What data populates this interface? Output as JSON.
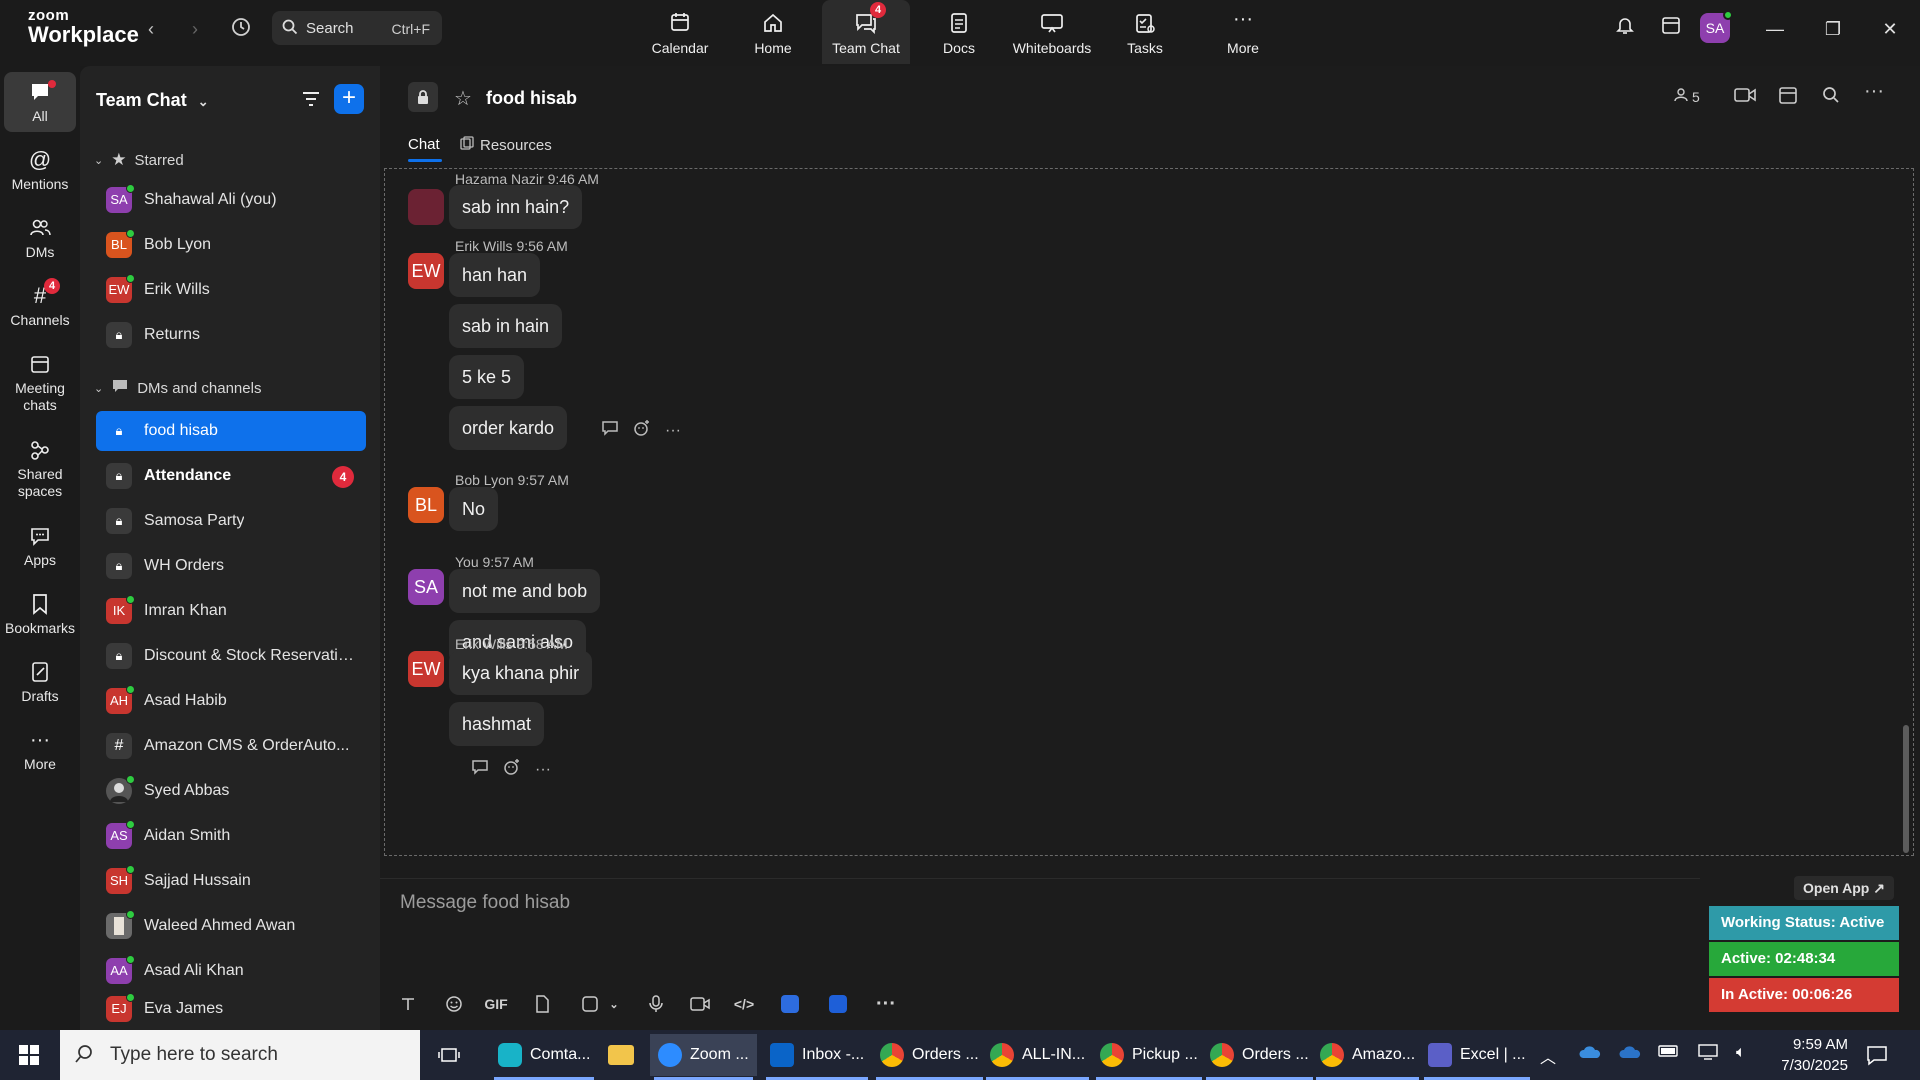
{
  "app": {
    "brand_top": "zoom",
    "brand_bottom": "Workplace"
  },
  "search": {
    "label": "Search",
    "shortcut": "Ctrl+F"
  },
  "top_nav": [
    {
      "label": "Calendar",
      "icon": "calendar-icon"
    },
    {
      "label": "Home",
      "icon": "home-icon"
    },
    {
      "label": "Team Chat",
      "icon": "chat-icon",
      "badge": "4",
      "active": true
    },
    {
      "label": "Docs",
      "icon": "docs-icon"
    },
    {
      "label": "Whiteboards",
      "icon": "whiteboard-icon"
    },
    {
      "label": "Tasks",
      "icon": "tasks-icon"
    },
    {
      "label": "More",
      "icon": "more-icon"
    }
  ],
  "user_initials": "SA",
  "rail": [
    {
      "label": "All",
      "icon": "chat-bubble-icon",
      "active": true
    },
    {
      "label": "Mentions",
      "icon": "at-icon"
    },
    {
      "label": "DMs",
      "icon": "people-icon"
    },
    {
      "label": "Channels",
      "icon": "hash-icon",
      "badge": "4"
    },
    {
      "label": "Meeting chats",
      "icon": "calendar-icon"
    },
    {
      "label": "Shared spaces",
      "icon": "shared-icon"
    },
    {
      "label": "Apps",
      "icon": "apps-icon"
    },
    {
      "label": "Bookmarks",
      "icon": "bookmark-icon"
    },
    {
      "label": "Drafts",
      "icon": "drafts-icon"
    },
    {
      "label": "More",
      "icon": "more-icon"
    }
  ],
  "sidebar": {
    "title": "Team Chat",
    "starred_label": "Starred",
    "starred": [
      {
        "name": "Shahawal Ali (you)",
        "initials": "SA",
        "color": "#8e3fae",
        "presence": true
      },
      {
        "name": "Bob Lyon",
        "initials": "BL",
        "color": "#d9541e",
        "presence": true
      },
      {
        "name": "Erik Wills",
        "initials": "EW",
        "color": "#c8362f",
        "presence": true
      },
      {
        "name": "Returns",
        "type": "locked"
      }
    ],
    "dms_label": "DMs and channels",
    "items": [
      {
        "name": "food hisab",
        "type": "locked",
        "active": true
      },
      {
        "name": "Attendance",
        "type": "locked",
        "bold": true,
        "badge": "4"
      },
      {
        "name": "Samosa Party",
        "type": "locked"
      },
      {
        "name": "WH Orders",
        "type": "locked"
      },
      {
        "name": "Imran Khan",
        "initials": "IK",
        "color": "#c8362f",
        "presence": true
      },
      {
        "name": "Discount & Stock Reservatio...",
        "type": "locked"
      },
      {
        "name": "Asad Habib",
        "initials": "AH",
        "color": "#c8362f",
        "presence": true
      },
      {
        "name": "Amazon CMS & OrderAuto...",
        "type": "hash"
      },
      {
        "name": "Syed Abbas",
        "type": "photo",
        "presence": true
      },
      {
        "name": "Aidan Smith",
        "initials": "AS",
        "color": "#8e3fae",
        "presence": true
      },
      {
        "name": "Sajjad Hussain",
        "initials": "SH",
        "color": "#c8362f",
        "presence": true
      },
      {
        "name": "Waleed Ahmed Awan",
        "type": "photo",
        "presence": true
      },
      {
        "name": "Asad Ali Khan",
        "initials": "AA",
        "color": "#8e3fae",
        "presence": true
      },
      {
        "name": "Eva James",
        "initials": "EJ",
        "color": "#c8362f",
        "presence": true
      }
    ]
  },
  "channel": {
    "title": "food hisab",
    "member_count": "5"
  },
  "tabs": [
    {
      "label": "Chat",
      "active": true
    },
    {
      "label": "Resources"
    }
  ],
  "messages": [
    {
      "sender": "Hazama Nazir",
      "time": "9:46 AM",
      "avatar_color": "#6b2233",
      "initials": "",
      "bubbles": [
        "sab inn hain?"
      ]
    },
    {
      "sender": "Erik Wills",
      "time": "9:56 AM",
      "avatar_color": "#c8362f",
      "initials": "EW",
      "bubbles": [
        "han han",
        "sab in hain",
        "5 ke 5",
        "order kardo"
      ]
    },
    {
      "sender": "Bob Lyon",
      "time": "9:57 AM",
      "avatar_color": "#d9541e",
      "initials": "BL",
      "bubbles": [
        "No"
      ]
    },
    {
      "sender": "You",
      "time": "9:57 AM",
      "avatar_color": "#8e3fae",
      "initials": "SA",
      "bubbles": [
        "not me and bob",
        "and sami also"
      ]
    },
    {
      "sender": "Erik Wills",
      "time": "9:58 AM",
      "avatar_color": "#c8362f",
      "initials": "EW",
      "bubbles": [
        "kya khana phir",
        "hashmat"
      ]
    }
  ],
  "composer": {
    "placeholder": "Message food hisab",
    "gif_label": "GIF"
  },
  "status_widget": {
    "open_app": "Open App ↗",
    "working_status": "Working Status: Active",
    "active": "Active: 02:48:34",
    "inactive": "In Active: 00:06:26",
    "colors": {
      "working": "#2e9aa8",
      "active": "#27a83a",
      "inactive": "#d43b33"
    }
  },
  "taskbar": {
    "search_placeholder": "Type here to search",
    "apps": [
      {
        "label": "Comta...",
        "icon": "comta-icon"
      },
      {
        "label": "",
        "icon": "folder-icon"
      },
      {
        "label": "Zoom ...",
        "icon": "zoom-icon",
        "active": true
      },
      {
        "label": "Inbox -...",
        "icon": "outlook-icon"
      },
      {
        "label": "Orders ...",
        "icon": "chrome-icon"
      },
      {
        "label": "ALL-IN...",
        "icon": "chrome-icon"
      },
      {
        "label": "Pickup ...",
        "icon": "chrome-icon"
      },
      {
        "label": "Orders ...",
        "icon": "chrome-icon"
      },
      {
        "label": "Amazo...",
        "icon": "chrome-icon"
      },
      {
        "label": "Excel | ...",
        "icon": "teams-icon"
      }
    ],
    "time": "9:59 AM",
    "date": "7/30/2025"
  }
}
